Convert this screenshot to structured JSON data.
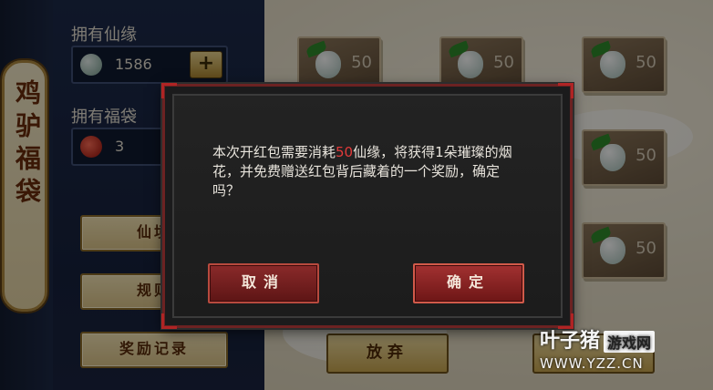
{
  "left_panel": {
    "banner_text": "鸡驴福袋",
    "xianyuan_label": "拥有仙缘",
    "xianyuan_value": "1586",
    "plus_label": "+",
    "fudai_label": "拥有福袋",
    "fudai_value": "3",
    "buttons": [
      "仙境",
      "规则",
      "奖励记录"
    ]
  },
  "cards": [
    "50",
    "50",
    "50",
    "50",
    "50",
    "50"
  ],
  "bottom_buttons": {
    "abandon": "放弃",
    "right": ""
  },
  "dialog": {
    "message_before": "本次开红包需要消耗",
    "message_highlight": "50",
    "message_after": "仙缘，将获得1朵璀璨的烟花，并免费赠送红包背后藏着的一个奖励，确定吗？",
    "cancel_label": "取消",
    "ok_label": "确定"
  },
  "watermark": {
    "brand": "叶子猪",
    "tag": "游戏网",
    "url": "WWW.YZZ.CN"
  },
  "colors": {
    "highlight": "#e23a3a",
    "dialog_button": "#a23131"
  }
}
